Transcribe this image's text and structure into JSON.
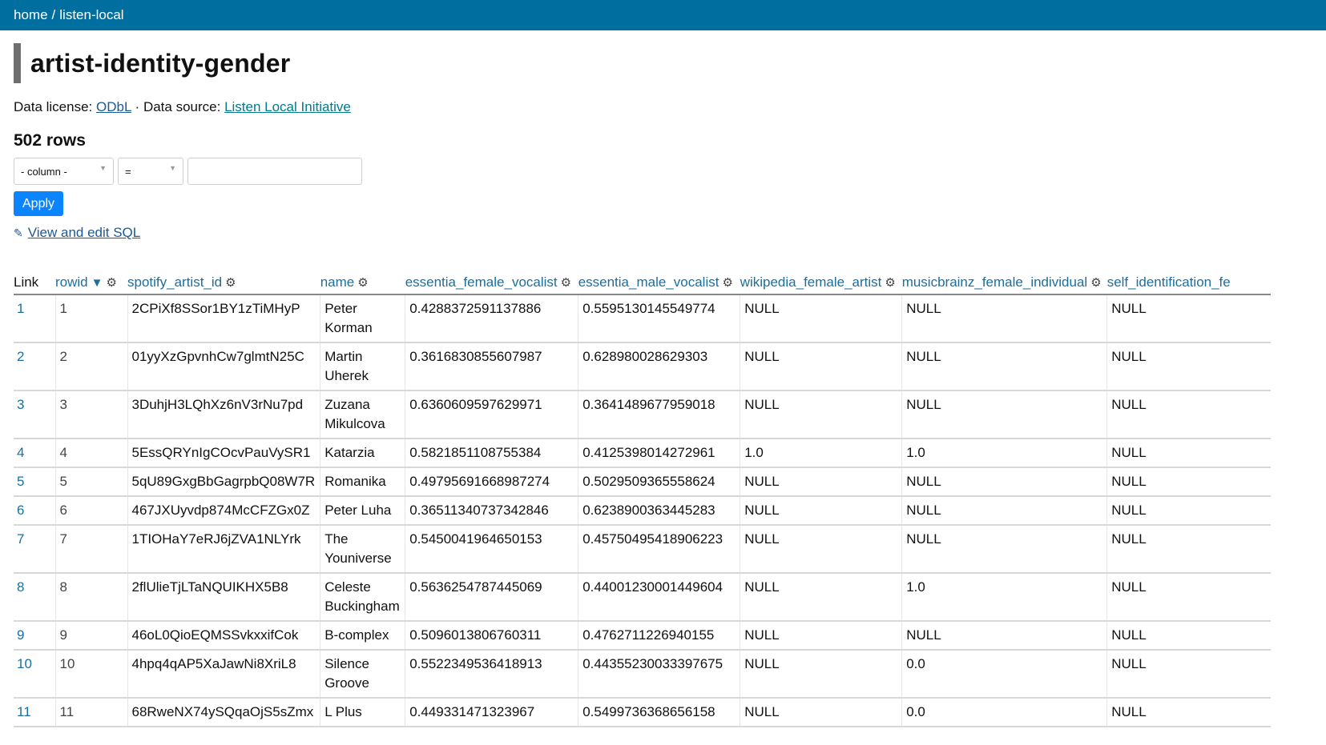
{
  "nav": {
    "home": "home",
    "separator": "/",
    "database": "listen-local"
  },
  "page": {
    "title": "artist-identity-gender",
    "license_label": "Data license:",
    "license_link": "ODbL",
    "dot": "·",
    "source_label": "Data source:",
    "source_link": "Listen Local Initiative",
    "row_count": "502 rows"
  },
  "filter": {
    "column_select": "- column -",
    "operator_select": "=",
    "value_input": "",
    "apply_label": "Apply"
  },
  "sql_link": {
    "icon": "pencil-icon",
    "glyph": "✎",
    "label": "View and edit SQL"
  },
  "table": {
    "columns": {
      "link": "Link",
      "rowid": "rowid",
      "spotify_artist_id": "spotify_artist_id",
      "name": "name",
      "essentia_female_vocalist": "essentia_female_vocalist",
      "essentia_male_vocalist": "essentia_male_vocalist",
      "wikipedia_female_artist": "wikipedia_female_artist",
      "musicbrainz_female_individual": "musicbrainz_female_individual",
      "self_identification": "self_identification_fe"
    },
    "sort_arrow": "▼",
    "gear_glyph": "⚙",
    "rows": [
      {
        "link": "1",
        "rowid": "1",
        "sid": "2CPiXf8SSor1BY1zTiMHyP",
        "name": "Peter Korman",
        "ef": "0.4288372591137886",
        "em": "0.5595130145549774",
        "wf": "NULL",
        "mf": "NULL",
        "self": "NULL"
      },
      {
        "link": "2",
        "rowid": "2",
        "sid": "01yyXzGpvnhCw7glmtN25C",
        "name": "Martin Uherek",
        "ef": "0.3616830855607987",
        "em": "0.628980028629303",
        "wf": "NULL",
        "mf": "NULL",
        "self": "NULL"
      },
      {
        "link": "3",
        "rowid": "3",
        "sid": "3DuhjH3LQhXz6nV3rNu7pd",
        "name": "Zuzana Mikulcova",
        "ef": "0.6360609597629971",
        "em": "0.3641489677959018",
        "wf": "NULL",
        "mf": "NULL",
        "self": "NULL"
      },
      {
        "link": "4",
        "rowid": "4",
        "sid": "5EssQRYnIgCOcvPauVySR1",
        "name": "Katarzia",
        "ef": "0.5821851108755384",
        "em": "0.4125398014272961",
        "wf": "1.0",
        "mf": "1.0",
        "self": "NULL"
      },
      {
        "link": "5",
        "rowid": "5",
        "sid": "5qU89GxgBbGagrpbQ08W7R",
        "name": "Romanika",
        "ef": "0.49795691668987274",
        "em": "0.5029509365558624",
        "wf": "NULL",
        "mf": "NULL",
        "self": "NULL"
      },
      {
        "link": "6",
        "rowid": "6",
        "sid": "467JXUyvdp874McCFZGx0Z",
        "name": "Peter Luha",
        "ef": "0.36511340737342846",
        "em": "0.6238900363445283",
        "wf": "NULL",
        "mf": "NULL",
        "self": "NULL"
      },
      {
        "link": "7",
        "rowid": "7",
        "sid": "1TIOHaY7eRJ6jZVA1NLYrk",
        "name": "The Youniverse",
        "ef": "0.5450041964650153",
        "em": "0.45750495418906223",
        "wf": "NULL",
        "mf": "NULL",
        "self": "NULL"
      },
      {
        "link": "8",
        "rowid": "8",
        "sid": "2flUlieTjLTaNQUIKHX5B8",
        "name": "Celeste Buckingham",
        "ef": "0.5636254787445069",
        "em": "0.44001230001449604",
        "wf": "NULL",
        "mf": "1.0",
        "self": "NULL"
      },
      {
        "link": "9",
        "rowid": "9",
        "sid": "46oL0QioEQMSSvkxxifCok",
        "name": "B-complex",
        "ef": "0.5096013806760311",
        "em": "0.4762711226940155",
        "wf": "NULL",
        "mf": "NULL",
        "self": "NULL"
      },
      {
        "link": "10",
        "rowid": "10",
        "sid": "4hpq4qAP5XaJawNi8XriL8",
        "name": "Silence Groove",
        "ef": "0.5522349536418913",
        "em": "0.44355230033397675",
        "wf": "NULL",
        "mf": "0.0",
        "self": "NULL"
      },
      {
        "link": "11",
        "rowid": "11",
        "sid": "68RweNX74ySQqaOjS5sZmx",
        "name": "L Plus",
        "ef": "0.449331471323967",
        "em": "0.5499736368656158",
        "wf": "NULL",
        "mf": "0.0",
        "self": "NULL"
      }
    ]
  }
}
